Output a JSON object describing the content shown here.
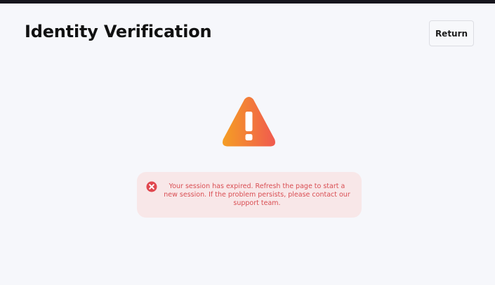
{
  "header": {
    "title": "Identity Verification",
    "return_label": "Return"
  },
  "main": {
    "status_icon": "warning-triangle-icon",
    "alert": {
      "icon": "error-circle-x-icon",
      "message": "Your session has expired. Refresh the page to start a new session. If the problem persists, please contact our support team."
    }
  },
  "colors": {
    "top_bar": "#16151d",
    "background": "#f6f7fb",
    "warning_gradient_start": "#f59e24",
    "warning_gradient_end": "#f05a4f",
    "alert_background": "#f8e7e8",
    "alert_text": "#d94d52"
  }
}
